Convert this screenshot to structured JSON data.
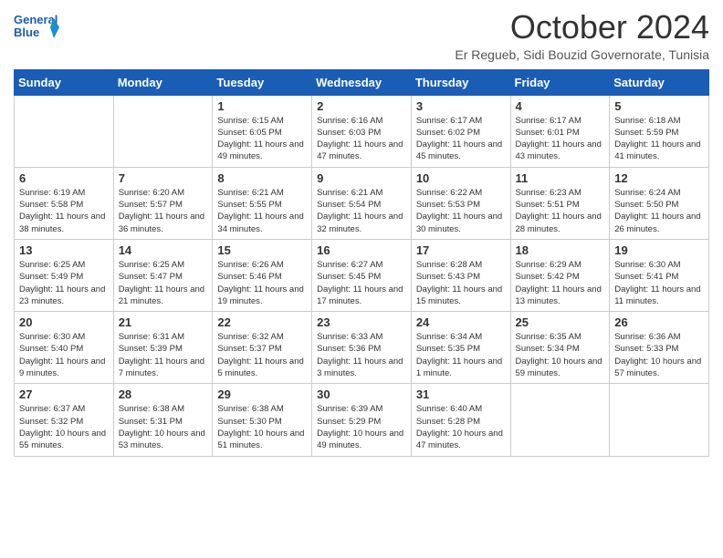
{
  "logo": {
    "line1": "General",
    "line2": "Blue"
  },
  "month": "October 2024",
  "subtitle": "Er Regueb, Sidi Bouzid Governorate, Tunisia",
  "days_of_week": [
    "Sunday",
    "Monday",
    "Tuesday",
    "Wednesday",
    "Thursday",
    "Friday",
    "Saturday"
  ],
  "weeks": [
    [
      {
        "day": "",
        "info": ""
      },
      {
        "day": "",
        "info": ""
      },
      {
        "day": "1",
        "info": "Sunrise: 6:15 AM\nSunset: 6:05 PM\nDaylight: 11 hours and 49 minutes."
      },
      {
        "day": "2",
        "info": "Sunrise: 6:16 AM\nSunset: 6:03 PM\nDaylight: 11 hours and 47 minutes."
      },
      {
        "day": "3",
        "info": "Sunrise: 6:17 AM\nSunset: 6:02 PM\nDaylight: 11 hours and 45 minutes."
      },
      {
        "day": "4",
        "info": "Sunrise: 6:17 AM\nSunset: 6:01 PM\nDaylight: 11 hours and 43 minutes."
      },
      {
        "day": "5",
        "info": "Sunrise: 6:18 AM\nSunset: 5:59 PM\nDaylight: 11 hours and 41 minutes."
      }
    ],
    [
      {
        "day": "6",
        "info": "Sunrise: 6:19 AM\nSunset: 5:58 PM\nDaylight: 11 hours and 38 minutes."
      },
      {
        "day": "7",
        "info": "Sunrise: 6:20 AM\nSunset: 5:57 PM\nDaylight: 11 hours and 36 minutes."
      },
      {
        "day": "8",
        "info": "Sunrise: 6:21 AM\nSunset: 5:55 PM\nDaylight: 11 hours and 34 minutes."
      },
      {
        "day": "9",
        "info": "Sunrise: 6:21 AM\nSunset: 5:54 PM\nDaylight: 11 hours and 32 minutes."
      },
      {
        "day": "10",
        "info": "Sunrise: 6:22 AM\nSunset: 5:53 PM\nDaylight: 11 hours and 30 minutes."
      },
      {
        "day": "11",
        "info": "Sunrise: 6:23 AM\nSunset: 5:51 PM\nDaylight: 11 hours and 28 minutes."
      },
      {
        "day": "12",
        "info": "Sunrise: 6:24 AM\nSunset: 5:50 PM\nDaylight: 11 hours and 26 minutes."
      }
    ],
    [
      {
        "day": "13",
        "info": "Sunrise: 6:25 AM\nSunset: 5:49 PM\nDaylight: 11 hours and 23 minutes."
      },
      {
        "day": "14",
        "info": "Sunrise: 6:25 AM\nSunset: 5:47 PM\nDaylight: 11 hours and 21 minutes."
      },
      {
        "day": "15",
        "info": "Sunrise: 6:26 AM\nSunset: 5:46 PM\nDaylight: 11 hours and 19 minutes."
      },
      {
        "day": "16",
        "info": "Sunrise: 6:27 AM\nSunset: 5:45 PM\nDaylight: 11 hours and 17 minutes."
      },
      {
        "day": "17",
        "info": "Sunrise: 6:28 AM\nSunset: 5:43 PM\nDaylight: 11 hours and 15 minutes."
      },
      {
        "day": "18",
        "info": "Sunrise: 6:29 AM\nSunset: 5:42 PM\nDaylight: 11 hours and 13 minutes."
      },
      {
        "day": "19",
        "info": "Sunrise: 6:30 AM\nSunset: 5:41 PM\nDaylight: 11 hours and 11 minutes."
      }
    ],
    [
      {
        "day": "20",
        "info": "Sunrise: 6:30 AM\nSunset: 5:40 PM\nDaylight: 11 hours and 9 minutes."
      },
      {
        "day": "21",
        "info": "Sunrise: 6:31 AM\nSunset: 5:39 PM\nDaylight: 11 hours and 7 minutes."
      },
      {
        "day": "22",
        "info": "Sunrise: 6:32 AM\nSunset: 5:37 PM\nDaylight: 11 hours and 5 minutes."
      },
      {
        "day": "23",
        "info": "Sunrise: 6:33 AM\nSunset: 5:36 PM\nDaylight: 11 hours and 3 minutes."
      },
      {
        "day": "24",
        "info": "Sunrise: 6:34 AM\nSunset: 5:35 PM\nDaylight: 11 hours and 1 minute."
      },
      {
        "day": "25",
        "info": "Sunrise: 6:35 AM\nSunset: 5:34 PM\nDaylight: 10 hours and 59 minutes."
      },
      {
        "day": "26",
        "info": "Sunrise: 6:36 AM\nSunset: 5:33 PM\nDaylight: 10 hours and 57 minutes."
      }
    ],
    [
      {
        "day": "27",
        "info": "Sunrise: 6:37 AM\nSunset: 5:32 PM\nDaylight: 10 hours and 55 minutes."
      },
      {
        "day": "28",
        "info": "Sunrise: 6:38 AM\nSunset: 5:31 PM\nDaylight: 10 hours and 53 minutes."
      },
      {
        "day": "29",
        "info": "Sunrise: 6:38 AM\nSunset: 5:30 PM\nDaylight: 10 hours and 51 minutes."
      },
      {
        "day": "30",
        "info": "Sunrise: 6:39 AM\nSunset: 5:29 PM\nDaylight: 10 hours and 49 minutes."
      },
      {
        "day": "31",
        "info": "Sunrise: 6:40 AM\nSunset: 5:28 PM\nDaylight: 10 hours and 47 minutes."
      },
      {
        "day": "",
        "info": ""
      },
      {
        "day": "",
        "info": ""
      }
    ]
  ]
}
